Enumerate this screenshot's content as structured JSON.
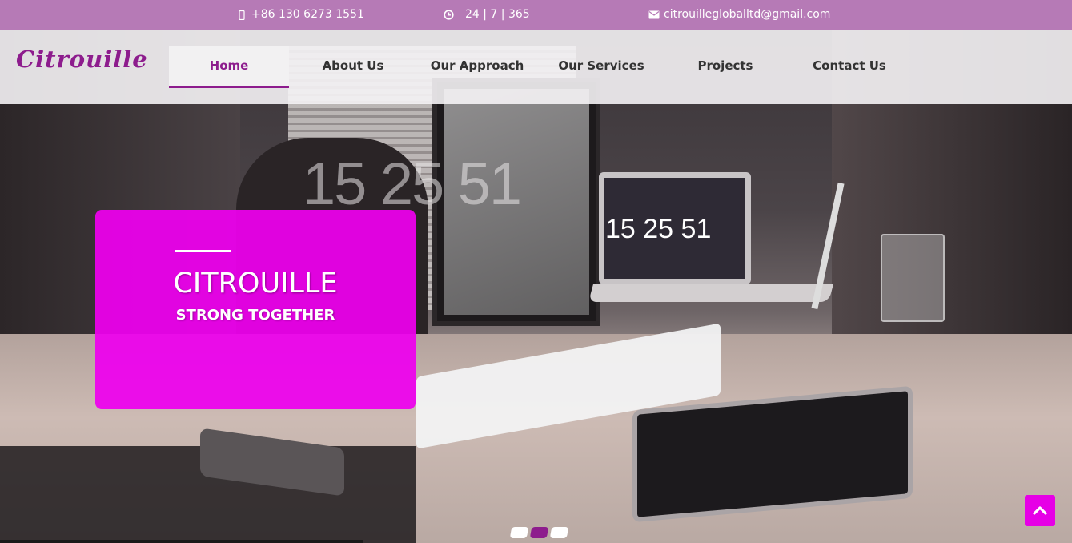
{
  "topbar": {
    "phone": "+86 130 6273 1551",
    "hours": "24 | 7 | 365",
    "email": "citrouillegloballtd@gmail.com",
    "bg_color": "#b67ab6"
  },
  "brand": {
    "logo_text": "Citrouille",
    "color": "#8d1c8d"
  },
  "nav": {
    "items": [
      {
        "label": "Home",
        "active": true
      },
      {
        "label": "About Us"
      },
      {
        "label": "Our Approach"
      },
      {
        "label": "Our Services"
      },
      {
        "label": "Projects"
      },
      {
        "label": "Contact Us"
      }
    ]
  },
  "hero": {
    "photo_clock_big": "15 25 51",
    "photo_clock_laptop": "15 25 51",
    "caption_title": "CITROUILLE",
    "caption_subtitle": "STRONG TOGETHER",
    "caption_color": "#ee00ee"
  },
  "slider": {
    "total_slides": 3,
    "active_index": 1
  },
  "icons": {
    "phone": "mobile-phone-icon",
    "clock": "clock-icon",
    "email": "envelope-icon",
    "scroll_top": "chevron-up-icon"
  }
}
